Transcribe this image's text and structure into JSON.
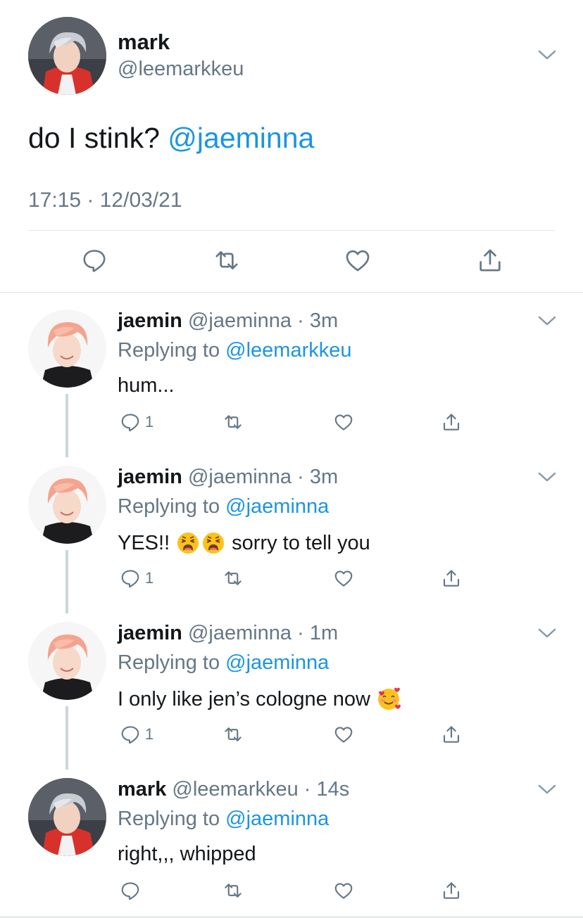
{
  "main_tweet": {
    "name": "mark",
    "handle": "@leemarkkeu",
    "text": "do I stink?",
    "mention": "@jaeminna",
    "timestamp": "17:15 · 12/03/21",
    "avatar_icon": "avatar-grey-hair-red-hoodie",
    "actions": [
      "reply-icon",
      "retweet-icon",
      "like-icon",
      "share-icon"
    ]
  },
  "replies": [
    {
      "name": "jaemin",
      "handle_time": "@jaeminna · 3m",
      "replying_prefix": "Replying to",
      "replying_to": "@leemarkkeu",
      "text": "hum...",
      "emojis": [],
      "text_after": "",
      "reply_count": "1",
      "avatar_icon": "avatar-pink-hair"
    },
    {
      "name": "jaemin",
      "handle_time": "@jaeminna · 3m",
      "replying_prefix": "Replying to",
      "replying_to": "@jaeminna",
      "text": "YES!!",
      "emojis": [
        "weary-face-emoji",
        "weary-face-emoji"
      ],
      "text_after": "sorry to tell you",
      "reply_count": "1",
      "avatar_icon": "avatar-pink-hair"
    },
    {
      "name": "jaemin",
      "handle_time": "@jaeminna · 1m",
      "replying_prefix": "Replying to",
      "replying_to": "@jaeminna",
      "text": "I only like jen’s cologne now",
      "emojis": [
        "smiling-face-with-hearts-emoji"
      ],
      "text_after": "",
      "reply_count": "1",
      "avatar_icon": "avatar-pink-hair"
    },
    {
      "name": "mark",
      "handle_time": "@leemarkkeu · 14s",
      "replying_prefix": "Replying to",
      "replying_to": "@jaeminna",
      "text": "right,,, whipped",
      "emojis": [],
      "text_after": "",
      "reply_count": "",
      "avatar_icon": "avatar-grey-hair-red-hoodie"
    }
  ],
  "colors": {
    "link": "#1b95e0",
    "secondary_text": "#657786",
    "divider": "#e1e8ed",
    "thread_line": "#ccd6dd"
  }
}
